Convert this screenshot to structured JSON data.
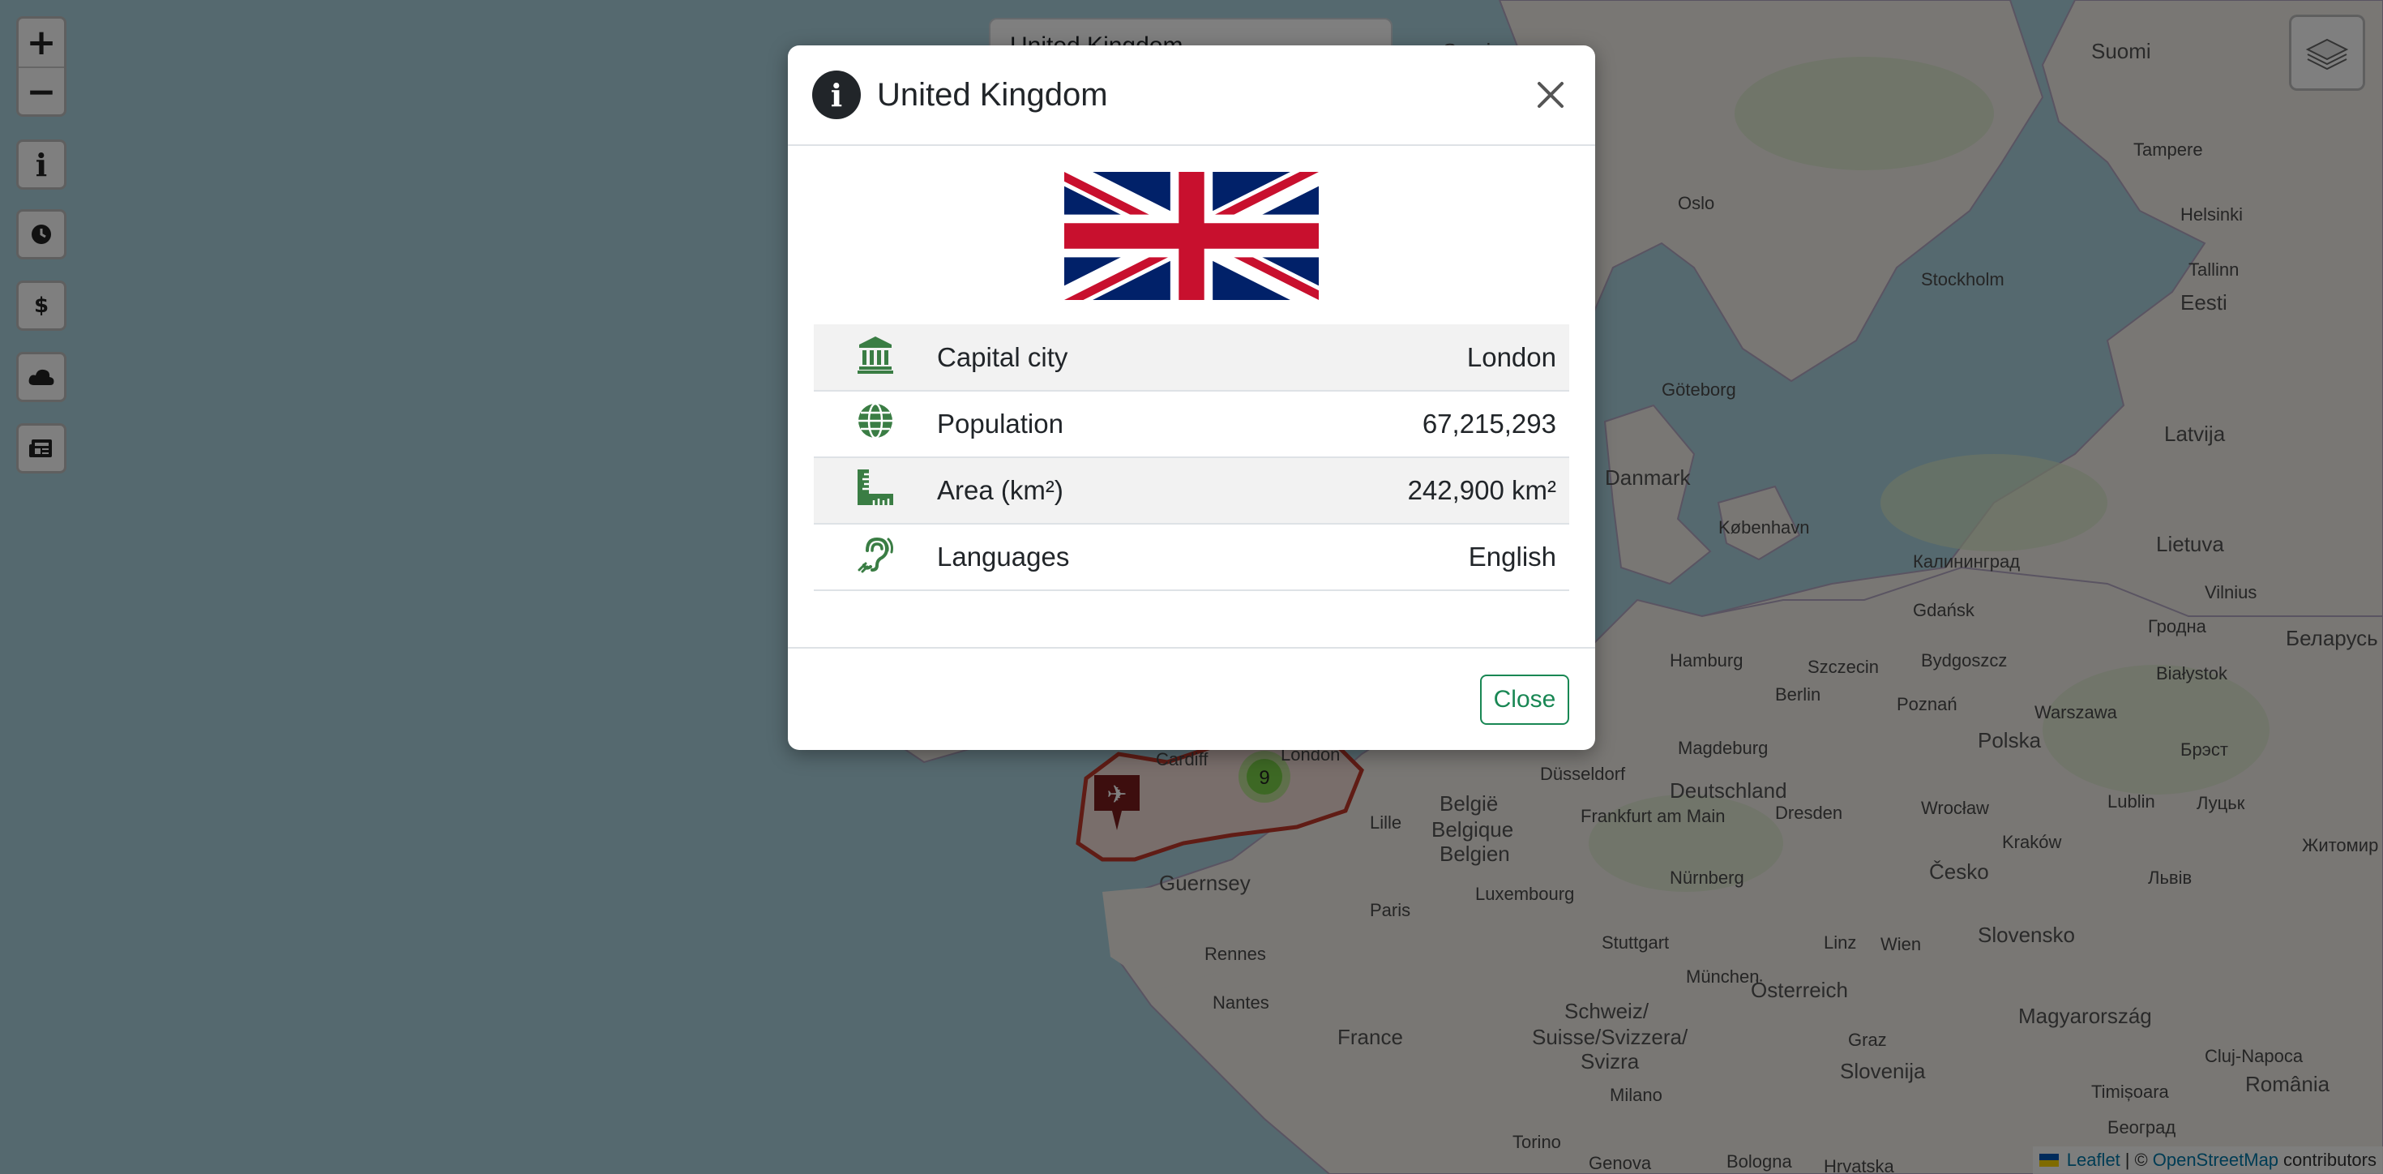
{
  "search": {
    "selected_country": "United Kingdom"
  },
  "zoom": {
    "in_label": "+",
    "out_label": "−"
  },
  "side_controls": [
    {
      "icon": "info-icon"
    },
    {
      "icon": "clock-icon"
    },
    {
      "icon": "dollar-icon"
    },
    {
      "icon": "cloud-icon"
    },
    {
      "icon": "newspaper-icon"
    }
  ],
  "layers": {
    "icon": "layers-icon"
  },
  "map_labels": {
    "sverige": "Sverige",
    "suomi": "Suomi",
    "tampere": "Tampere",
    "oslo": "Oslo",
    "helsinki": "Helsinki",
    "tallinn": "Tallinn",
    "stockholm": "Stockholm",
    "eesti": "Eesti",
    "goteborg": "Göteborg",
    "latvija": "Latvija",
    "danmark": "Danmark",
    "kobenhavn": "København",
    "lietuva": "Lietuva",
    "vilnius": "Vilnius",
    "kaliningrad": "Калининград",
    "gdansk": "Gdańsk",
    "hamburg": "Hamburg",
    "szczecin": "Szczecin",
    "bydgoszcz": "Bydgoszcz",
    "bialystok": "Białystok",
    "grodno": "Гродна",
    "belarus": "Беларусь",
    "berlin": "Berlin",
    "poznan": "Poznań",
    "warszawa": "Warszawa",
    "polska": "Polska",
    "brest": "Брэст",
    "magdeburg": "Magdeburg",
    "dusseldorf": "Düsseldorf",
    "deutschland": "Deutschland",
    "lille": "Lille",
    "belgie": "België",
    "belgique": "Belgique",
    "belgien": "Belgien",
    "frankfurt": "Frankfurt am Main",
    "dresden": "Dresden",
    "wroclaw": "Wrocław",
    "lublin": "Lublin",
    "lutsk": "Луцьк",
    "zhytomyr": "Житомир",
    "luxembourg": "Luxembourg",
    "nurnberg": "Nürnberg",
    "cesko": "Česko",
    "krakow": "Kraków",
    "lviv": "Львів",
    "guernsey": "Guernsey",
    "paris": "Paris",
    "rennes": "Rennes",
    "stuttgart": "Stuttgart",
    "munchen": "München",
    "linz": "Linz",
    "wien": "Wien",
    "slovensko": "Slovensko",
    "nantes": "Nantes",
    "osterreich": "Österreich",
    "france": "France",
    "schweiz": "Schweiz/",
    "suisse": "Suisse/Svizzera/",
    "svizra": "Svizra",
    "graz": "Graz",
    "magyarorszag": "Magyarország",
    "cluj": "Cluj-Napoca",
    "romania": "România",
    "slovenija": "Slovenija",
    "milano": "Milano",
    "timisoara": "Timișoara",
    "beograd": "Београд",
    "torino": "Torino",
    "genova": "Genova",
    "bologna": "Bologna",
    "hrvatska": "Hrvatska",
    "cardiff": "Cardiff",
    "london": "London",
    "cluster_count": "9"
  },
  "modal": {
    "title": "United Kingdom",
    "rows": [
      {
        "icon": "landmark-icon",
        "label": "Capital city",
        "value": "London"
      },
      {
        "icon": "globe-icon",
        "label": "Population",
        "value": "67,215,293"
      },
      {
        "icon": "ruler-icon",
        "label": "Area (km²)",
        "value": "242,900 km²"
      },
      {
        "icon": "ear-icon",
        "label": "Languages",
        "value": "English"
      }
    ],
    "close_label": "Close"
  },
  "attribution": {
    "leaflet": "Leaflet",
    "separator": "|",
    "copy": "©",
    "osm": "OpenStreetMap",
    "contributors": "contributors"
  },
  "colors": {
    "accent": "#198754",
    "icon_green": "#3a7d44",
    "overlay": "rgba(0,0,0,0.5)",
    "flag_blue": "#012169",
    "flag_red": "#C8102E"
  }
}
